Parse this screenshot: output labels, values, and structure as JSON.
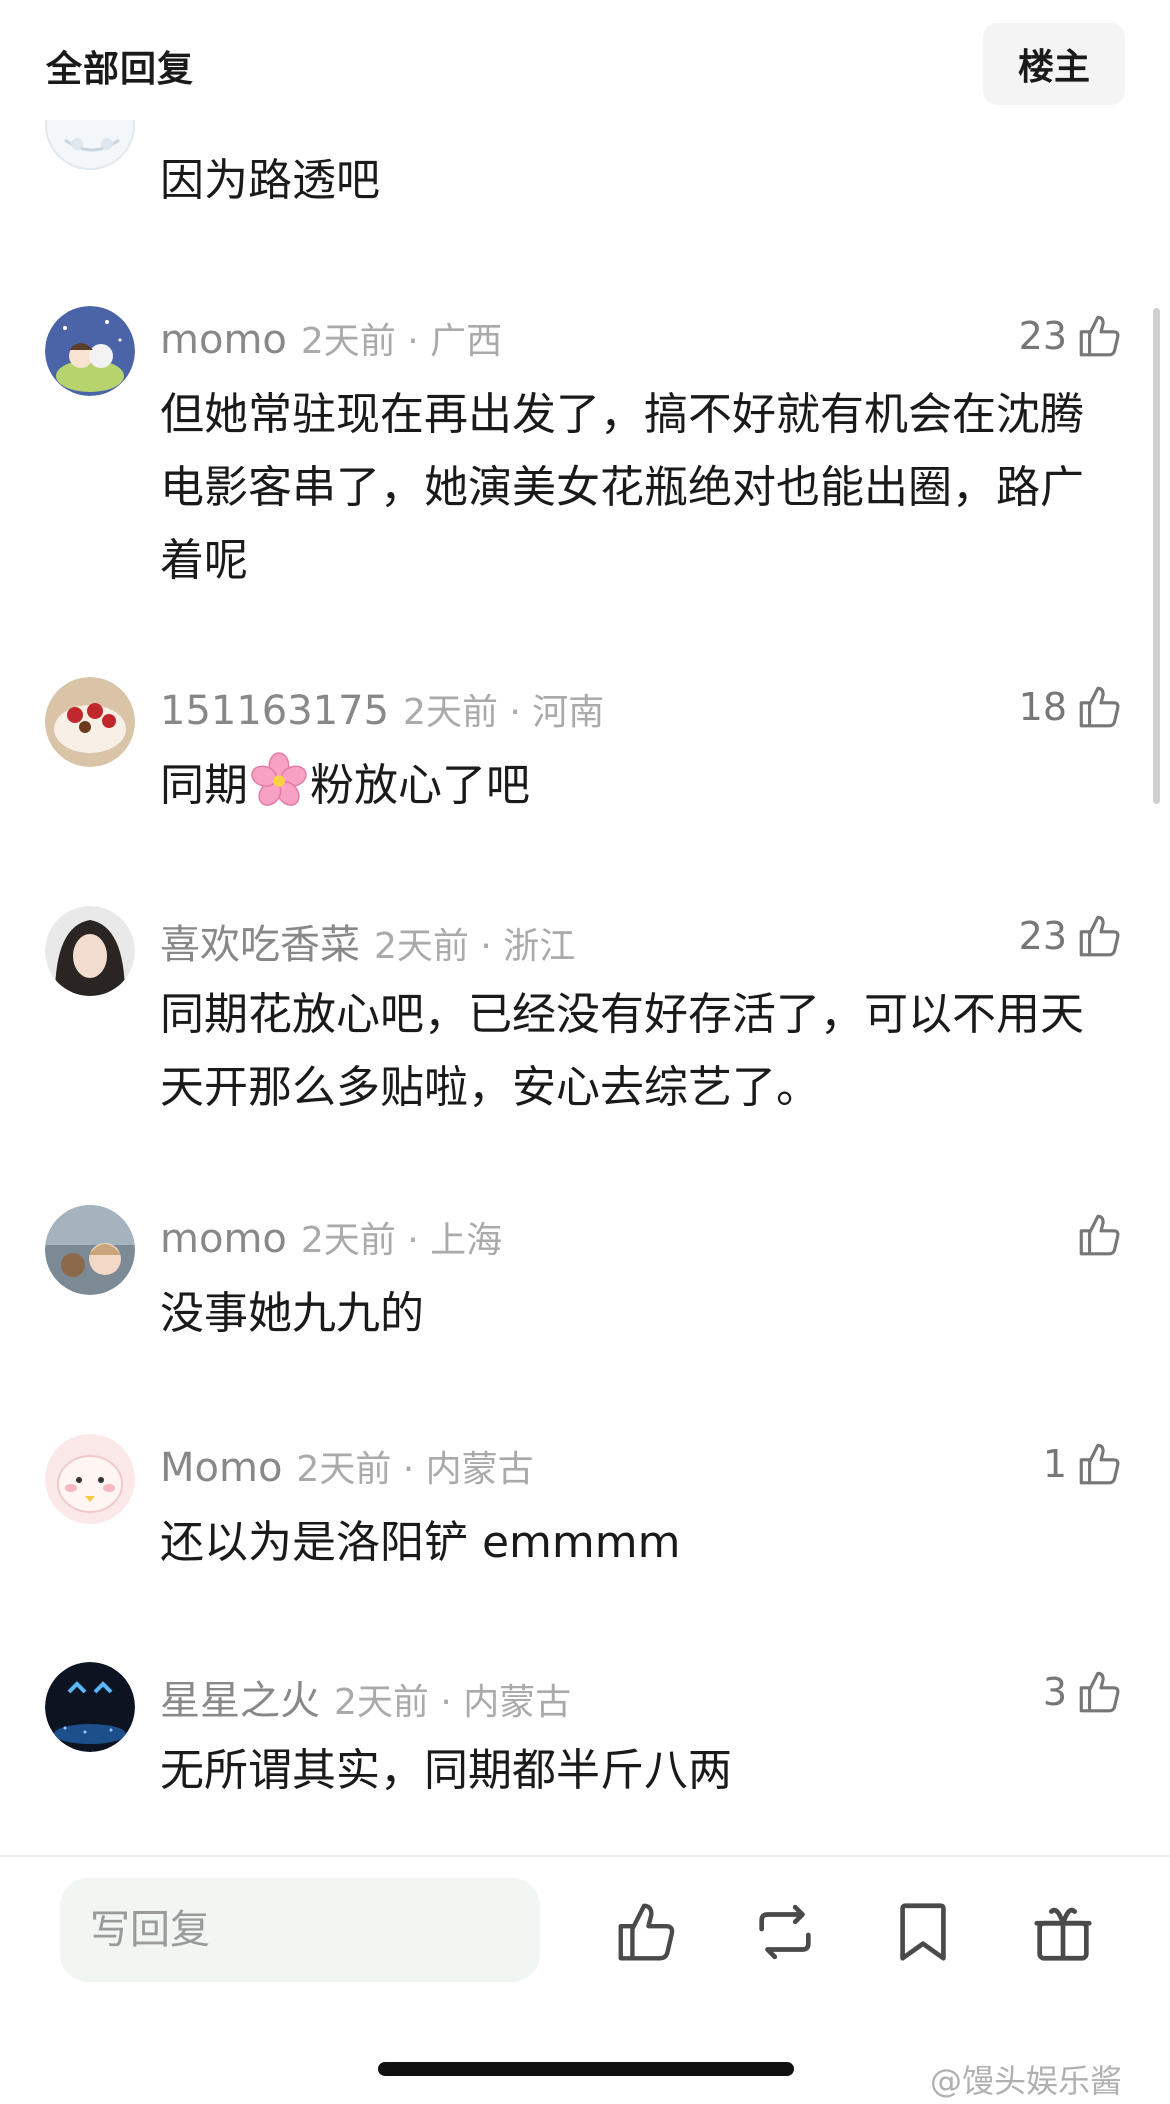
{
  "header": {
    "title": "全部回复",
    "op_button": "楼主"
  },
  "partial_comment": {
    "text": "因为路透吧"
  },
  "comments": [
    {
      "name": "momo",
      "time_location": "2天前 · 广西",
      "likes": "23",
      "content": "但她常驻现在再出发了，搞不好就有机会在沈腾电影客串了，她演美女花瓶绝对也能出圈，路广着呢"
    },
    {
      "name": "151163175",
      "time_location": "2天前 · 河南",
      "likes": "18",
      "content_before": "同期",
      "content_after": "粉放心了吧"
    },
    {
      "name": "喜欢吃香菜",
      "time_location": "2天前 · 浙江",
      "likes": "23",
      "content": "同期花放心吧，已经没有好存活了，可以不用天天开那么多贴啦，安心去综艺了。"
    },
    {
      "name": "momo",
      "time_location": "2天前 · 上海",
      "likes": "",
      "content": "没事她九九的"
    },
    {
      "name": "Momo",
      "time_location": "2天前 · 内蒙古",
      "likes": "1",
      "content": "还以为是洛阳铲 emmmm"
    },
    {
      "name": "星星之火",
      "time_location": "2天前 · 内蒙古",
      "likes": "3",
      "content": "无所谓其实，同期都半斤八两"
    }
  ],
  "bottom_bar": {
    "reply_placeholder": "写回复"
  },
  "watermark": "@馒头娱乐酱",
  "icons": {
    "like": "thumb-up-icon",
    "repost": "repost-icon",
    "bookmark": "bookmark-icon",
    "gift": "gift-icon",
    "emoji": "cherry-blossom-icon"
  }
}
